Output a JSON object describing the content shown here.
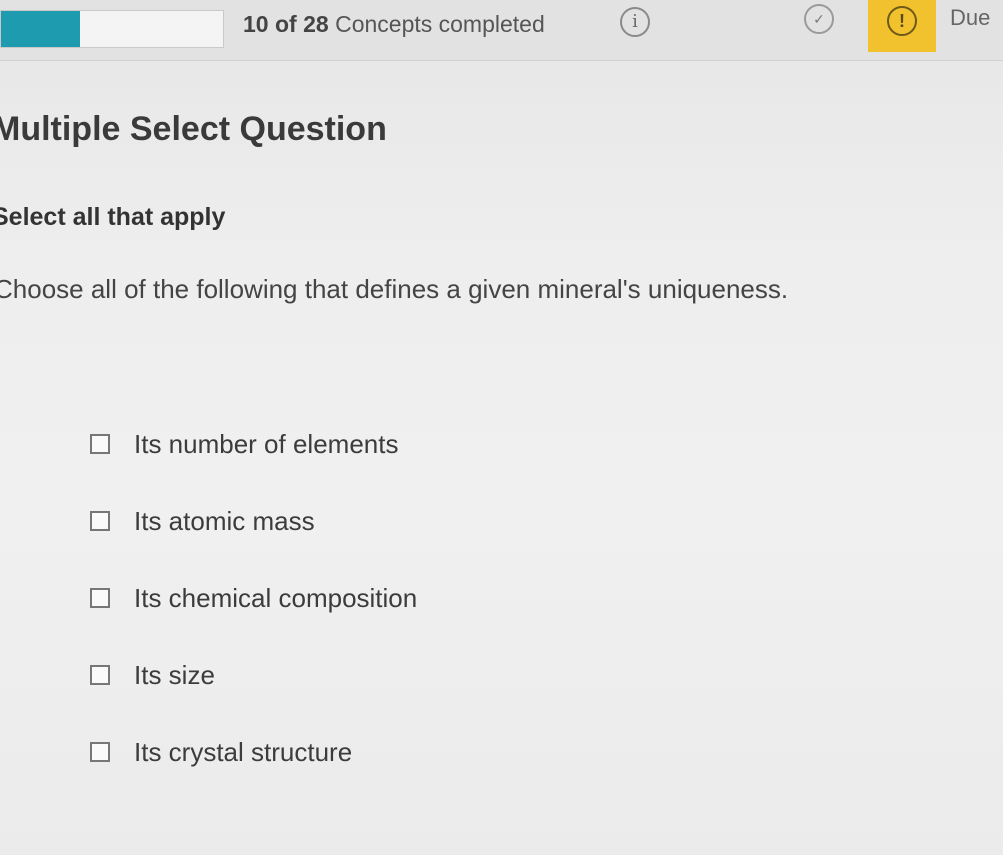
{
  "header": {
    "progress": {
      "completed": "10",
      "of_label": "of",
      "total": "28",
      "suffix": "Concepts completed",
      "fraction": 0.357
    },
    "icons": {
      "info": "i",
      "check": "✓",
      "alert": "!"
    },
    "due_label": "Due",
    "colors": {
      "progress_fill": "#1f9bb0",
      "alert_bg": "#f2c12e"
    }
  },
  "question": {
    "type_label": "Multiple Select Question",
    "instruction": "Select all that apply",
    "prompt": "Choose all of the following that defines a given mineral's uniqueness.",
    "options": [
      {
        "label": "Its number of elements",
        "checked": false
      },
      {
        "label": "Its atomic mass",
        "checked": false
      },
      {
        "label": "Its chemical composition",
        "checked": false
      },
      {
        "label": "Its size",
        "checked": false
      },
      {
        "label": "Its crystal structure",
        "checked": false
      }
    ]
  }
}
